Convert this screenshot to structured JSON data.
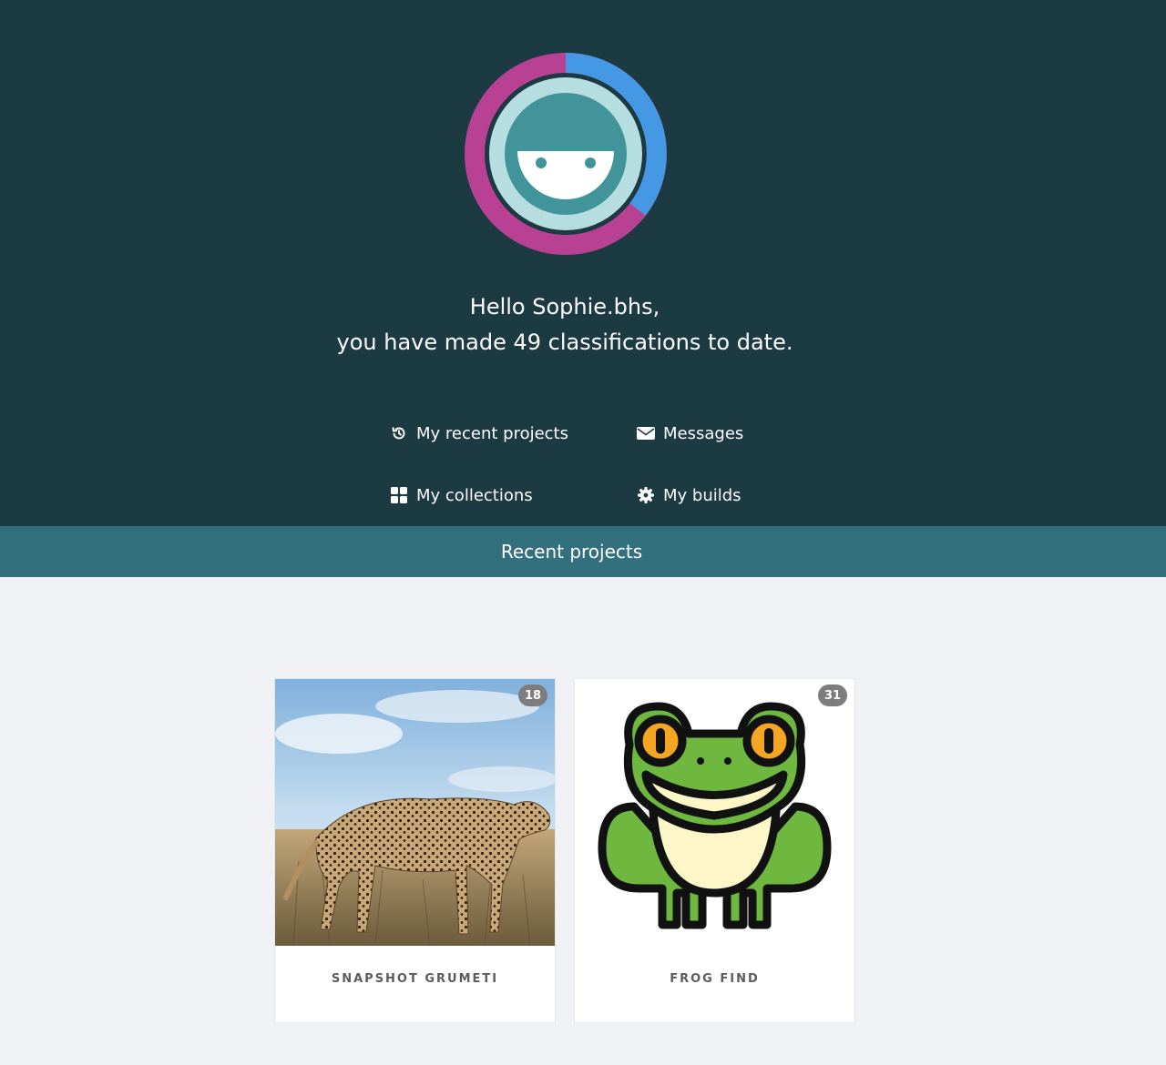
{
  "colors": {
    "hero_bg": "#1c3a42",
    "band_bg": "#33707d",
    "page_bg": "#eff1f4",
    "ring_magenta": "#b94194",
    "ring_blue": "#4598e3",
    "avatar_teal": "#41959a",
    "avatar_light": "#b6dddf"
  },
  "profile": {
    "avatar_icon": "zooniverse-smiley-avatar",
    "greeting_line1": "Hello Sophie.bhs,",
    "greeting_line2": "you have made 49 classifications to date."
  },
  "nav": {
    "recent_projects": {
      "label": "My recent projects",
      "icon": "history-icon"
    },
    "messages": {
      "label": "Messages",
      "icon": "envelope-icon"
    },
    "collections": {
      "label": "My collections",
      "icon": "grid-icon"
    },
    "builds": {
      "label": "My builds",
      "icon": "gear-icon"
    }
  },
  "section_title": "Recent projects",
  "projects": [
    {
      "name": "SNAPSHOT GRUMETI",
      "count": "18",
      "image": "cheetah-photo"
    },
    {
      "name": "FROG FIND",
      "count": "31",
      "image": "frog-illustration"
    }
  ]
}
